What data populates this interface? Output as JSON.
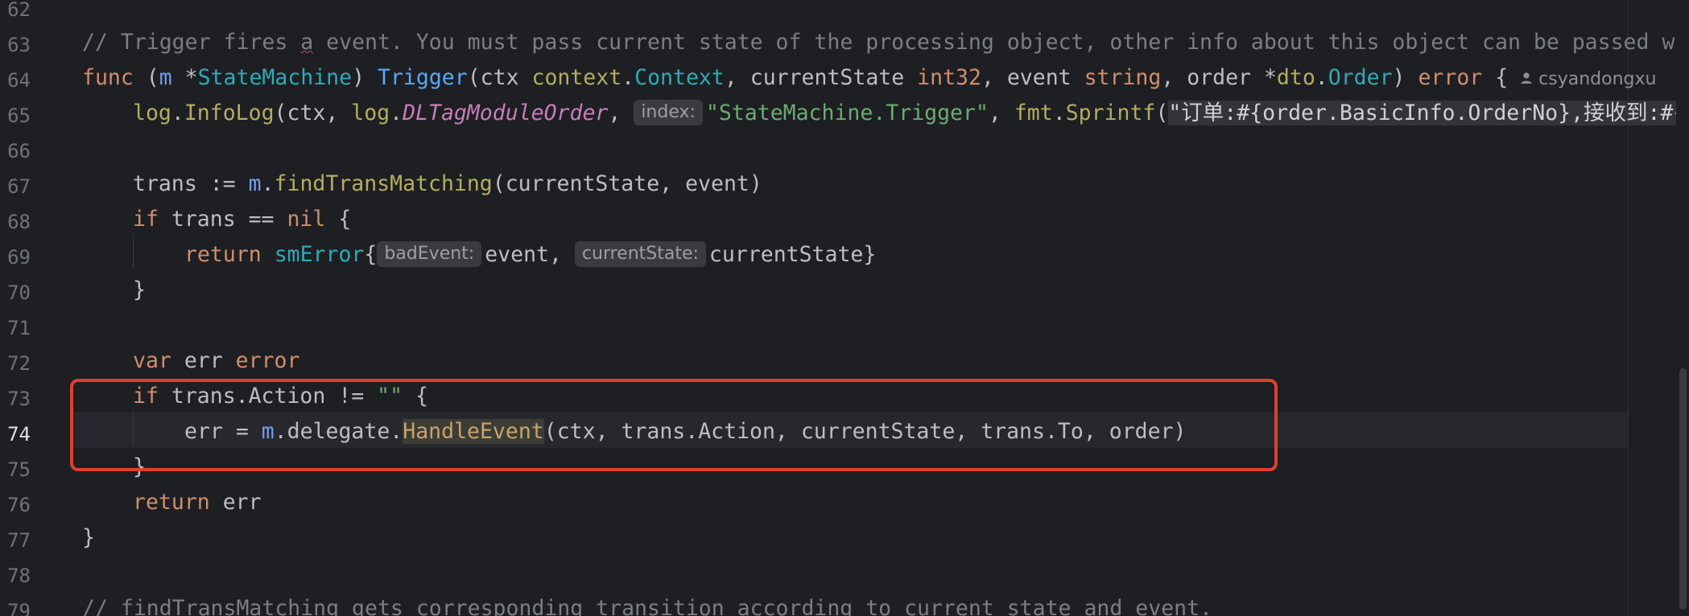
{
  "editor": {
    "current_line": "74",
    "gutter": [
      "62",
      "63",
      "64",
      "65",
      "66",
      "67",
      "68",
      "69",
      "70",
      "71",
      "72",
      "73",
      "74",
      "75",
      "76",
      "77",
      "78",
      "79"
    ],
    "author": "csyandongxu",
    "line63": {
      "comment_a": "// Trigger fires ",
      "comment_b": "a",
      "comment_c": " event. You must pass current state of the processing object, other info about this object can be passed wi"
    },
    "line64": {
      "func": "func",
      "open": " (",
      "recv": "m",
      "star_type": " *",
      "type": "StateMachine",
      "close": ") ",
      "name": "Trigger",
      "p1": "(ctx ",
      "ctxpkg": "context",
      "dot": ".",
      "ctxtype": "Context",
      "p2": ", currentState ",
      "int32": "int32",
      "p3": ", event ",
      "string": "string",
      "p4": ", order *",
      "dtopkg": "dto",
      "dot2": ".",
      "order": "Order",
      "p5": ") ",
      "error": "error",
      "p6": " {"
    },
    "line65": {
      "log1": "log",
      "dot1": ".",
      "infolog": "InfoLog",
      "p1": "(ctx, ",
      "log2": "log",
      "dot2": ".",
      "tag": "DLTagModuleOrder",
      "p2": ", ",
      "hint": "index:",
      "str": "\"StateMachine.Trigger\"",
      "p3": ", ",
      "fmt": "fmt",
      "dot3": ".",
      "sprintf": "Sprintf",
      "p4": "(",
      "fmtstr": "\"订单:#{order.BasicInfo.OrderNo},接收到:#{"
    },
    "line67": {
      "a": "trans := ",
      "recv": "m",
      "dot": ".",
      "fn": "findTransMatching",
      "b": "(currentState, event)"
    },
    "line68": {
      "if": "if",
      "a": " trans == ",
      "nil": "nil",
      "b": " {"
    },
    "line69": {
      "ret": "return",
      "sp": " ",
      "sm": "smError",
      "brace": "{",
      "hint1": "badEvent:",
      "a": "event, ",
      "hint2": "currentState:",
      "b": "currentState}"
    },
    "line70": {
      "a": "}"
    },
    "line72": {
      "var": "var",
      "a": " err ",
      "error": "error"
    },
    "line73": {
      "if": "if",
      "a": " trans.Action != ",
      "str": "\"\"",
      "b": " {"
    },
    "line74": {
      "a": "err = ",
      "recv": "m",
      "b": ".delegate.",
      "fn": "HandleEvent",
      "c": "(ctx, trans.Action, currentState, trans.To, order)"
    },
    "line75": {
      "a": "}"
    },
    "line76": {
      "ret": "return",
      "a": " err"
    },
    "line77": {
      "a": "}"
    },
    "line79": {
      "comment": "// findTransMatching gets corresponding transition according to current state and event."
    }
  }
}
